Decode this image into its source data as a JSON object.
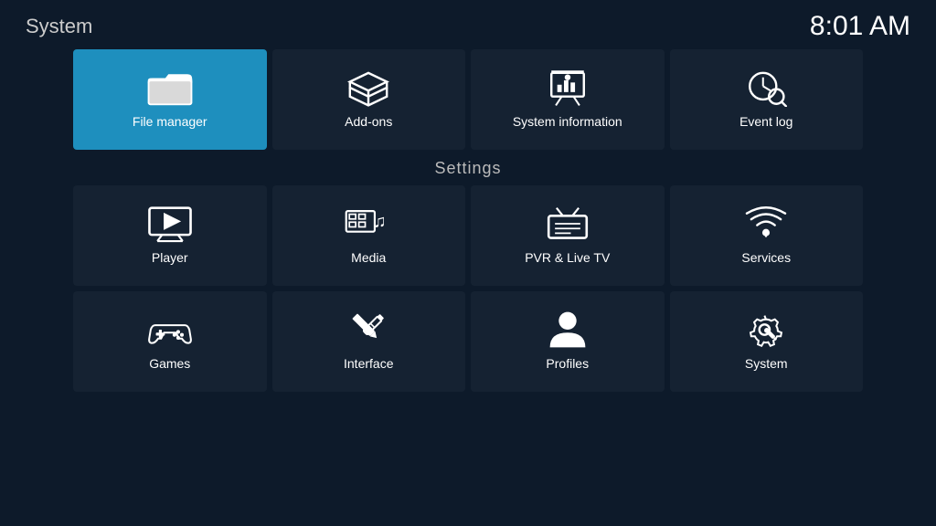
{
  "header": {
    "title": "System",
    "time": "8:01 AM"
  },
  "topRow": [
    {
      "id": "file-manager",
      "label": "File manager",
      "icon": "folder",
      "active": true
    },
    {
      "id": "add-ons",
      "label": "Add-ons",
      "icon": "addons",
      "active": false
    },
    {
      "id": "system-information",
      "label": "System information",
      "icon": "sysinfo",
      "active": false
    },
    {
      "id": "event-log",
      "label": "Event log",
      "icon": "eventlog",
      "active": false
    }
  ],
  "settings": {
    "label": "Settings"
  },
  "settingsRow1": [
    {
      "id": "player",
      "label": "Player",
      "icon": "player"
    },
    {
      "id": "media",
      "label": "Media",
      "icon": "media"
    },
    {
      "id": "pvr-live-tv",
      "label": "PVR & Live TV",
      "icon": "pvr"
    },
    {
      "id": "services",
      "label": "Services",
      "icon": "services"
    }
  ],
  "settingsRow2": [
    {
      "id": "games",
      "label": "Games",
      "icon": "games"
    },
    {
      "id": "interface",
      "label": "Interface",
      "icon": "interface"
    },
    {
      "id": "profiles",
      "label": "Profiles",
      "icon": "profiles"
    },
    {
      "id": "system",
      "label": "System",
      "icon": "system"
    }
  ]
}
